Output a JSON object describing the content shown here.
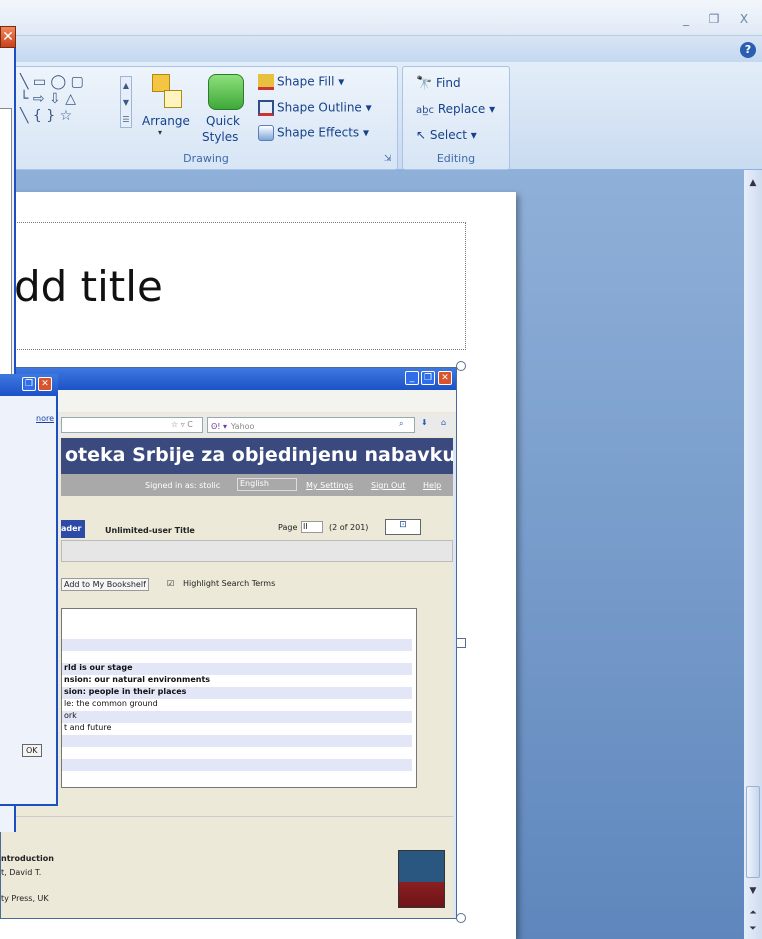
{
  "window": {
    "minimize": "_",
    "restore": "❐",
    "close": "X",
    "help": "?"
  },
  "ribbon": {
    "drawing": {
      "label": "Drawing",
      "arrange": "Arrange",
      "quick_styles_1": "Quick",
      "quick_styles_2": "Styles",
      "shape_fill": "Shape Fill",
      "shape_outline": "Shape Outline",
      "shape_effects": "Shape Effects"
    },
    "editing": {
      "label": "Editing",
      "find": "Find",
      "replace": "Replace",
      "select": "Select"
    }
  },
  "slide": {
    "title_text": "dd title"
  },
  "browser": {
    "search_engine": "Yahoo",
    "header": "oteka Srbije za objedinjenu nabavku",
    "signed_in": "Signed in as: stolic",
    "language": "English",
    "my_settings": "My Settings",
    "sign_out": "Sign Out",
    "help": "Help",
    "reader": "ader",
    "unlimited": "Unlimited-user Title",
    "page_label": "Page",
    "page_value": "II",
    "page_count": "(2 of 201)",
    "add_bookshelf": "Add to My Bookshelf",
    "highlight": "Highlight Search Terms",
    "toc_rows": [
      {
        "text": "",
        "bold": false,
        "shade": true
      },
      {
        "text": "",
        "bold": false,
        "shade": false
      },
      {
        "text": "rld is our stage",
        "bold": true,
        "shade": true
      },
      {
        "text": "nsion: our natural environments",
        "bold": true,
        "shade": false
      },
      {
        "text": "sion: people in their places",
        "bold": true,
        "shade": true
      },
      {
        "text": "le: the common ground",
        "bold": false,
        "shade": false
      },
      {
        "text": "ork",
        "bold": false,
        "shade": true
      },
      {
        "text": "t and future",
        "bold": false,
        "shade": false
      },
      {
        "text": "",
        "bold": false,
        "shade": true
      },
      {
        "text": "",
        "bold": false,
        "shade": false
      },
      {
        "text": "",
        "bold": false,
        "shade": true
      }
    ],
    "book_title": "ntroduction",
    "book_author": "t, David T.",
    "book_publisher": "ty Press, UK"
  },
  "sub_dialog": {
    "more": "nore",
    "ok": "OK"
  },
  "colors": {
    "ribbon": "#dbe7f6",
    "accent": "#15428b",
    "close": "#d9542b"
  }
}
